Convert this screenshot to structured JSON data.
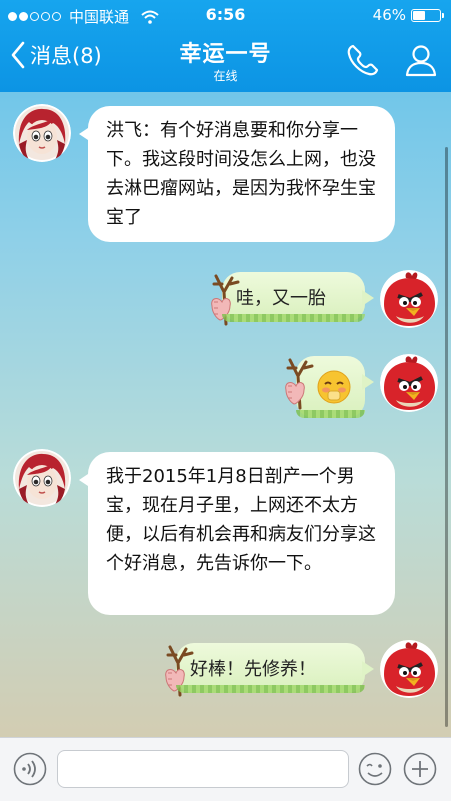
{
  "status_bar": {
    "carrier": "中国联通",
    "time": "6:56",
    "battery": "46%",
    "battery_level": 0.46,
    "signal_dots_filled": 2
  },
  "nav": {
    "back_label": "消息(8)",
    "title": "幸运一号",
    "subtitle": "在线"
  },
  "messages": [
    {
      "side": "left",
      "text": "洪飞：有个好消息要和你分享一下。我这段时间没怎么上网，也没去淋巴瘤网站，是因为我怀孕生宝宝了",
      "avatar": "girl-avatar"
    },
    {
      "side": "right",
      "text": "哇，又一胎",
      "avatar": "red-bird-avatar"
    },
    {
      "side": "right",
      "text": "",
      "emoji": "blush-emoji",
      "avatar": "red-bird-avatar"
    },
    {
      "side": "left",
      "text": "我于2015年1月8日剖产一个男宝，现在月子里，上网还不太方便，以后有机会再和病友们分享这个好消息，先告诉你一下。",
      "avatar": "girl-avatar"
    },
    {
      "side": "right",
      "text": "好棒！先修养！",
      "avatar": "red-bird-avatar"
    }
  ],
  "input_bar": {
    "placeholder": "",
    "value": "",
    "icons": [
      "voice-icon",
      "emoji-face-icon",
      "plus-icon"
    ]
  },
  "colors": {
    "nav_blue": "#0c94e4",
    "bubble_green": "#d9f0bd",
    "bubble_white": "#ffffff"
  }
}
